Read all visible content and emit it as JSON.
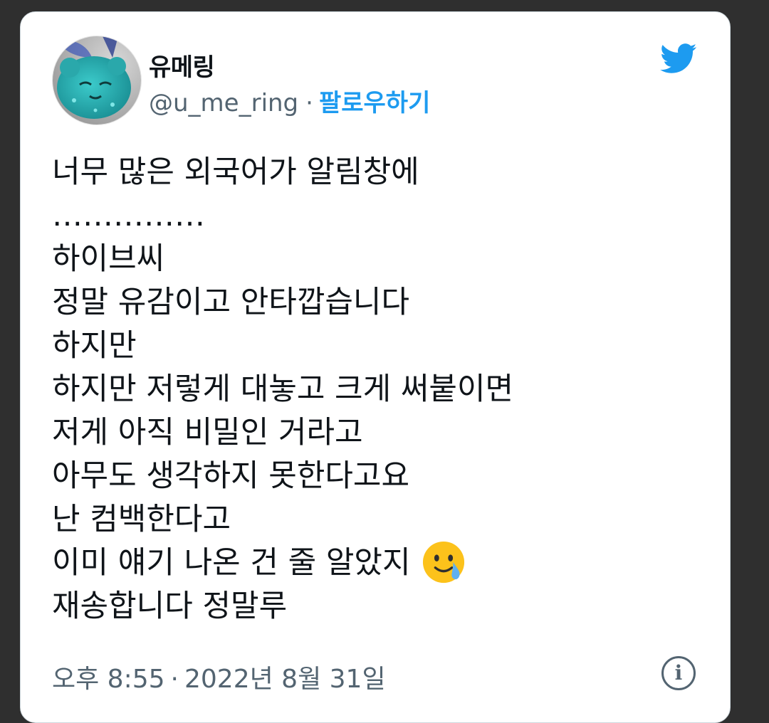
{
  "user": {
    "display_name": "유메링",
    "handle": "@u_me_ring",
    "separator": "·",
    "follow_label": "팔로우하기",
    "avatar_icon": "avatar-teal-bear-icon"
  },
  "brand": {
    "icon": "twitter-bird-icon",
    "color": "#1d9bf0"
  },
  "tweet": {
    "lines": [
      "너무 많은 외국어가 알림창에",
      "……………",
      "하이브씨",
      "정말 유감이고 안타깝습니다",
      "하지만",
      "하지만 저렇게 대놓고 크게 써붙이면",
      "저게 아직 비밀인 거라고",
      "아무도 생각하지 못한다고요",
      "난 컴백한다고",
      "이미 얘기 나온 건 줄 알았지",
      "재송합니다 정말루"
    ],
    "emoji_icon": "smiling-face-with-tear-icon"
  },
  "meta": {
    "time": "오후 8:55",
    "separator": "·",
    "date": "2022년 8월 31일",
    "info_label": "i",
    "info_icon": "info-icon"
  }
}
